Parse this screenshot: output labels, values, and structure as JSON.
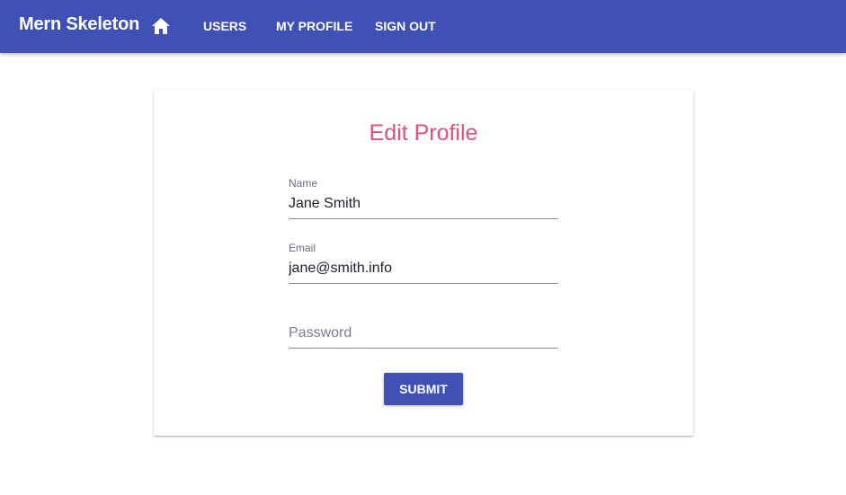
{
  "appbar": {
    "brand": "Mern Skeleton",
    "home_icon": "home-icon",
    "nav": [
      "USERS",
      "MY PROFILE",
      "SIGN OUT"
    ]
  },
  "card": {
    "title": "Edit Profile",
    "name_label": "Name",
    "name_value": "Jane Smith",
    "email_label": "Email",
    "email_value": "jane@smith.info",
    "password_placeholder": "Password",
    "submit_label": "SUBMIT"
  },
  "colors": {
    "primary": "#3f51b5",
    "title": "#e0527a"
  }
}
